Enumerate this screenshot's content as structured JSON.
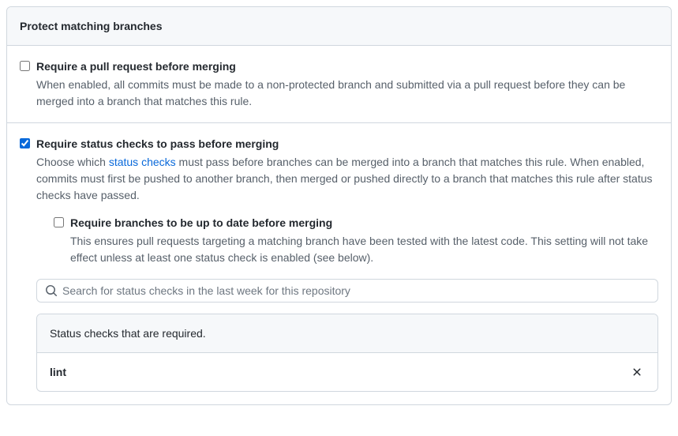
{
  "header": {
    "title": "Protect matching branches"
  },
  "options": {
    "require_pr": {
      "checked": false,
      "title": "Require a pull request before merging",
      "desc": "When enabled, all commits must be made to a non-protected branch and submitted via a pull request before they can be merged into a branch that matches this rule."
    },
    "require_status": {
      "checked": true,
      "title": "Require status checks to pass before merging",
      "desc_pre": "Choose which ",
      "link_text": "status checks",
      "desc_post": " must pass before branches can be merged into a branch that matches this rule. When enabled, commits must first be pushed to another branch, then merged or pushed directly to a branch that matches this rule after status checks have passed."
    },
    "require_uptodate": {
      "checked": false,
      "title": "Require branches to be up to date before merging",
      "desc": "This ensures pull requests targeting a matching branch have been tested with the latest code. This setting will not take effect unless at least one status check is enabled (see below)."
    }
  },
  "search": {
    "placeholder": "Search for status checks in the last week for this repository"
  },
  "required_box": {
    "header": "Status checks that are required.",
    "items": [
      "lint"
    ]
  }
}
